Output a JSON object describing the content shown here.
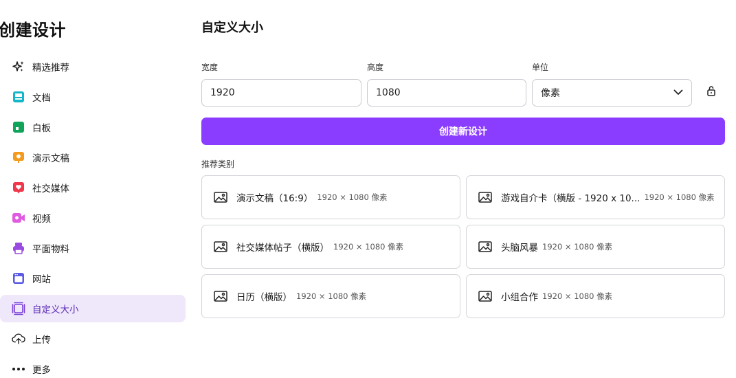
{
  "sidebar": {
    "title": "创建设计",
    "items": [
      {
        "label": "精选推荐",
        "icon": "sparkle-icon",
        "color": "#1a1a1a"
      },
      {
        "label": "文档",
        "icon": "document-icon",
        "color": "#13b5c9"
      },
      {
        "label": "白板",
        "icon": "whiteboard-icon",
        "color": "#10a35a"
      },
      {
        "label": "演示文稿",
        "icon": "presentation-icon",
        "color": "#f49a1c"
      },
      {
        "label": "社交媒体",
        "icon": "heart-icon",
        "color": "#f0384d"
      },
      {
        "label": "视频",
        "icon": "video-icon",
        "color": "#e05be0"
      },
      {
        "label": "平面物料",
        "icon": "printer-icon",
        "color": "#9a4be0"
      },
      {
        "label": "网站",
        "icon": "website-icon",
        "color": "#5a5ae6"
      },
      {
        "label": "自定义大小",
        "icon": "custom-size-icon",
        "color": "#7a3fd6"
      },
      {
        "label": "上传",
        "icon": "cloud-upload-icon",
        "color": "#1a1a1a"
      },
      {
        "label": "更多",
        "icon": "more-dots-icon",
        "color": "#1a1a1a"
      }
    ],
    "active_index": 8
  },
  "main": {
    "title": "自定义大小",
    "width_label": "宽度",
    "width_value": "1920",
    "height_label": "高度",
    "height_value": "1080",
    "unit_label": "单位",
    "unit_value": "像素",
    "create_button": "创建新设计",
    "recommended_label": "推荐类别",
    "categories": [
      {
        "name": "演示文稿（16:9）",
        "size": "1920 × 1080 像素"
      },
      {
        "name": "游戏自介卡（横版 - 1920 x 10...",
        "size": "1920 × 1080 像素"
      },
      {
        "name": "社交媒体帖子（横版）",
        "size": "1920 × 1080 像素"
      },
      {
        "name": "头脑风暴",
        "size": "1920 × 1080 像素"
      },
      {
        "name": "日历（横版）",
        "size": "1920 × 1080 像素"
      },
      {
        "name": "小组合作",
        "size": "1920 × 1080 像素"
      }
    ]
  },
  "colors": {
    "accent": "#8b3dff",
    "active_bg": "#efe8fb",
    "active_text": "#5b2bb5"
  }
}
